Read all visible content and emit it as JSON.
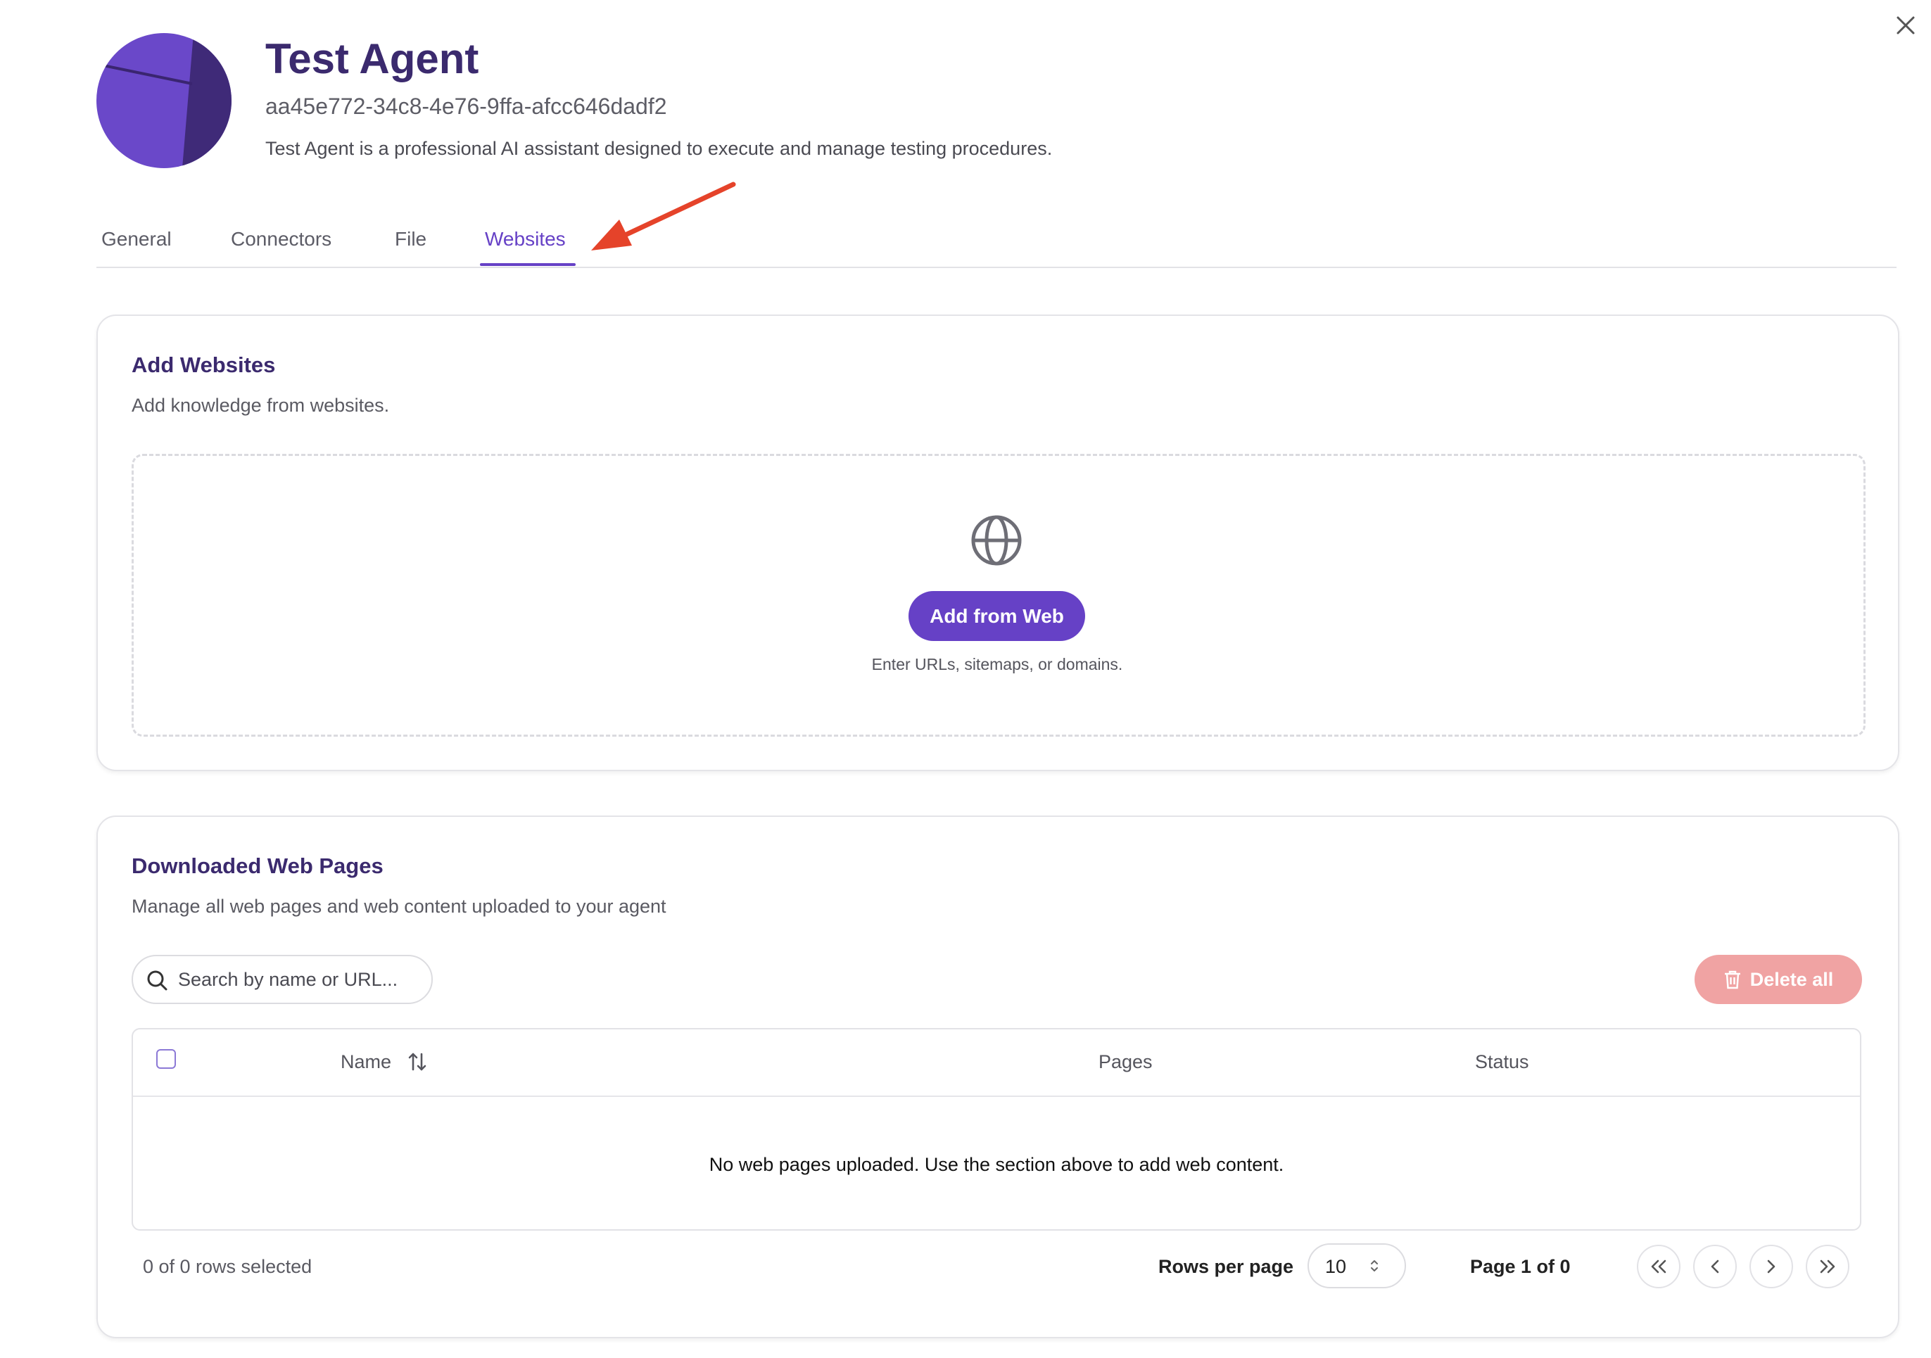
{
  "agent": {
    "name": "Test Agent",
    "id": "aa45e772-34c8-4e76-9ffa-afcc646dadf2",
    "description": "Test Agent is a professional AI assistant designed to execute and manage testing procedures."
  },
  "tabs": [
    {
      "label": "General",
      "active": false
    },
    {
      "label": "Connectors",
      "active": false
    },
    {
      "label": "File",
      "active": false
    },
    {
      "label": "Websites",
      "active": true
    }
  ],
  "add_websites": {
    "title": "Add Websites",
    "subtitle": "Add knowledge from websites.",
    "button_label": "Add from Web",
    "hint": "Enter URLs, sitemaps, or domains.",
    "icon": "globe-icon"
  },
  "downloaded": {
    "title": "Downloaded Web Pages",
    "subtitle": "Manage all web pages and web content uploaded to your agent",
    "search_placeholder": "Search by name or URL...",
    "delete_all_label": "Delete all",
    "columns": [
      "Name",
      "Pages",
      "Status"
    ],
    "empty_message": "No web pages uploaded. Use the section above to add web content.",
    "rows_selected": "0 of 0 rows selected",
    "rows_per_page_label": "Rows per page",
    "rows_per_page_value": "10",
    "page_info": "Page 1 of 0"
  },
  "colors": {
    "accent": "#6641c6",
    "title": "#3b2a6e",
    "delete_disabled": "#f0a3a3",
    "annotation_arrow": "#e5432a"
  }
}
